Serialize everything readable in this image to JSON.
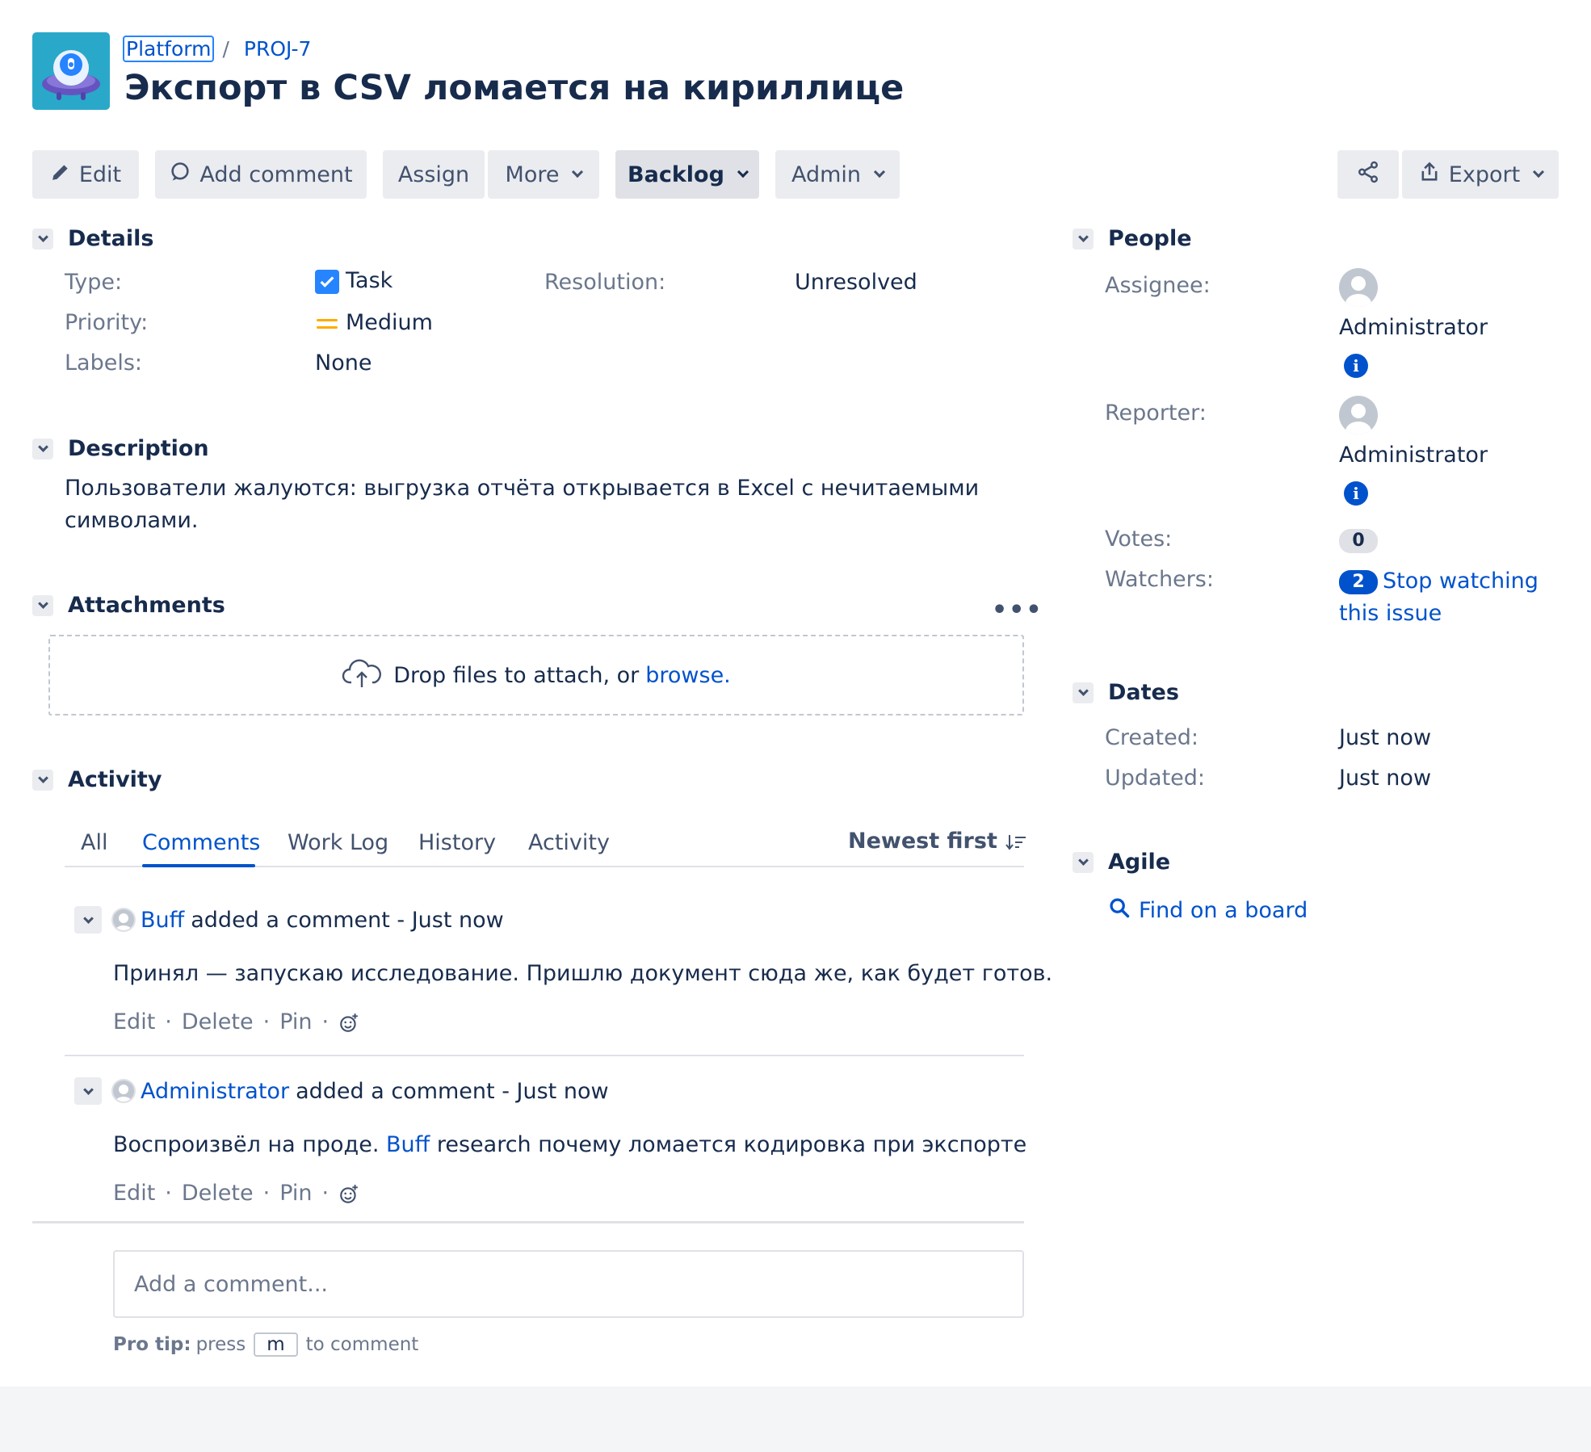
{
  "breadcrumbs": {
    "project": "Platform",
    "separator": "/",
    "issue_key": "PROJ-7"
  },
  "issue": {
    "title": "Экспорт в CSV ломается на кириллице"
  },
  "toolbar": {
    "edit": "Edit",
    "add_comment": "Add comment",
    "assign": "Assign",
    "more": "More",
    "status": "Backlog",
    "admin": "Admin",
    "export": "Export"
  },
  "details": {
    "heading": "Details",
    "type_label": "Type:",
    "type_value": "Task",
    "priority_label": "Priority:",
    "priority_value": "Medium",
    "labels_label": "Labels:",
    "labels_value": "None",
    "resolution_label": "Resolution:",
    "resolution_value": "Unresolved"
  },
  "description": {
    "heading": "Description",
    "text": "Пользователи жалуются: выгрузка отчёта открывается в Excel с нечитаемыми символами."
  },
  "attachments": {
    "heading": "Attachments",
    "more": "•••",
    "drop_text": "Drop files to attach, or",
    "browse": "browse."
  },
  "activity": {
    "heading": "Activity",
    "tabs": [
      "All",
      "Comments",
      "Work Log",
      "History",
      "Activity"
    ],
    "active_tab": "Comments",
    "sort": "Newest first"
  },
  "comments": [
    {
      "author": "Buff",
      "meta": "added a comment - Just now",
      "body": "Принял — запускаю исследование. Пришлю документ сюда же, как будет готов.",
      "actions": [
        "Edit",
        "Delete",
        "Pin"
      ]
    },
    {
      "author": "Administrator",
      "meta": "added a comment - Just now",
      "body_before": "Воспроизвёл на проде.",
      "mention": "Buff",
      "body_after": "research почему ломается кодировка при экспорте",
      "actions": [
        "Edit",
        "Delete",
        "Pin"
      ]
    }
  ],
  "comment_box": {
    "placeholder": "Add a comment...",
    "protip_bold": "Pro tip:",
    "protip_pre": "press",
    "protip_key": "m",
    "protip_post": "to comment"
  },
  "people": {
    "heading": "People",
    "assignee_label": "Assignee:",
    "assignee": "Administrator",
    "reporter_label": "Reporter:",
    "reporter": "Administrator",
    "votes_label": "Votes:",
    "votes": "0",
    "watchers_label": "Watchers:",
    "watchers": "2",
    "watch_link_1": "Stop watching",
    "watch_link_2": "this issue"
  },
  "dates": {
    "heading": "Dates",
    "created_label": "Created:",
    "created": "Just now",
    "updated_label": "Updated:",
    "updated": "Just now"
  },
  "agile": {
    "heading": "Agile",
    "find": "Find on a board"
  },
  "colors": {
    "link": "#0052cc",
    "text": "#172b4d",
    "muted": "#6b778c",
    "button_bg": "#ebecf0",
    "priority": "#ffab00"
  }
}
